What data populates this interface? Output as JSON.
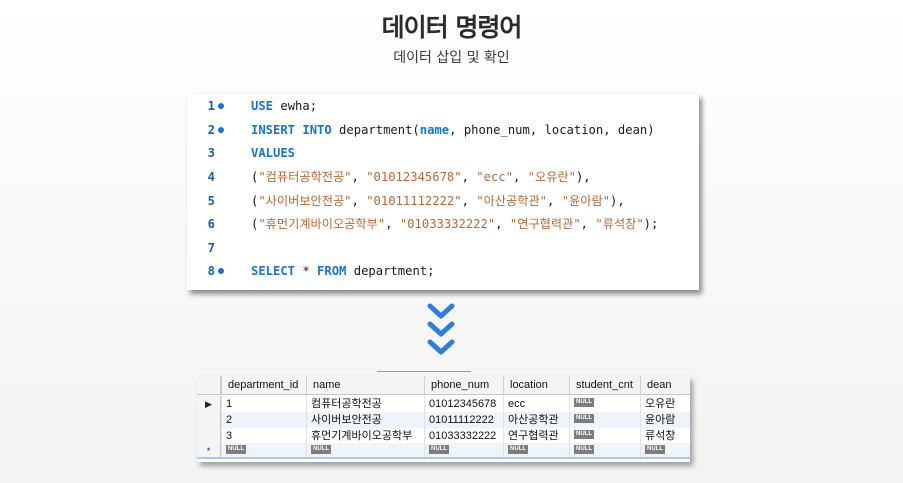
{
  "header": {
    "title": "데이터 명령어",
    "subtitle": "데이터 삽입 및 확인"
  },
  "code_editor": {
    "lines": [
      {
        "num": "1",
        "has_dot": true,
        "tokens": [
          {
            "t": "USE",
            "c": "kw"
          },
          {
            "t": " ewha;",
            "c": "txt"
          }
        ]
      },
      {
        "num": "2",
        "has_dot": true,
        "tokens": [
          {
            "t": "INSERT INTO",
            "c": "kw"
          },
          {
            "t": " department(",
            "c": "txt"
          },
          {
            "t": "name",
            "c": "col"
          },
          {
            "t": ", phone_num, location, dean)",
            "c": "txt"
          }
        ]
      },
      {
        "num": "3",
        "has_dot": false,
        "tokens": [
          {
            "t": "VALUES",
            "c": "kw"
          }
        ]
      },
      {
        "num": "4",
        "has_dot": false,
        "tokens": [
          {
            "t": "(",
            "c": "txt"
          },
          {
            "t": "\"컴퓨터공학전공\"",
            "c": "str"
          },
          {
            "t": ", ",
            "c": "txt"
          },
          {
            "t": "\"01012345678\"",
            "c": "str"
          },
          {
            "t": ", ",
            "c": "txt"
          },
          {
            "t": "\"ecc\"",
            "c": "str"
          },
          {
            "t": ", ",
            "c": "txt"
          },
          {
            "t": "\"오유란\"",
            "c": "str"
          },
          {
            "t": "),",
            "c": "txt"
          }
        ]
      },
      {
        "num": "5",
        "has_dot": false,
        "tokens": [
          {
            "t": "(",
            "c": "txt"
          },
          {
            "t": "\"사이버보안전공\"",
            "c": "str"
          },
          {
            "t": ", ",
            "c": "txt"
          },
          {
            "t": "\"01011112222\"",
            "c": "str"
          },
          {
            "t": ", ",
            "c": "txt"
          },
          {
            "t": "\"아산공학관\"",
            "c": "str"
          },
          {
            "t": ", ",
            "c": "txt"
          },
          {
            "t": "\"윤아람\"",
            "c": "str"
          },
          {
            "t": "),",
            "c": "txt"
          }
        ]
      },
      {
        "num": "6",
        "has_dot": false,
        "tokens": [
          {
            "t": "(",
            "c": "txt"
          },
          {
            "t": "\"휴먼기계바이오공학부\"",
            "c": "str"
          },
          {
            "t": ", ",
            "c": "txt"
          },
          {
            "t": "\"01033332222\"",
            "c": "str"
          },
          {
            "t": ", ",
            "c": "txt"
          },
          {
            "t": "\"연구협력관\"",
            "c": "str"
          },
          {
            "t": ", ",
            "c": "txt"
          },
          {
            "t": "\"류석창\"",
            "c": "str"
          },
          {
            "t": ");",
            "c": "txt"
          }
        ]
      },
      {
        "num": "7",
        "has_dot": false,
        "tokens": []
      },
      {
        "num": "8",
        "has_dot": true,
        "tokens": [
          {
            "t": "SELECT",
            "c": "kw"
          },
          {
            "t": " * ",
            "c": "txt"
          },
          {
            "t": "FROM",
            "c": "kw"
          },
          {
            "t": " department;",
            "c": "txt"
          }
        ]
      }
    ]
  },
  "arrow_icon": "triple-chevron-down-icon",
  "result_grid": {
    "columns": [
      "department_id",
      "name",
      "phone_num",
      "location",
      "student_cnt",
      "dean"
    ],
    "rows": [
      {
        "selector": "▶",
        "cells": [
          "1",
          "컴퓨터공학전공",
          "01012345678",
          "ecc",
          "NULL",
          "오유란"
        ]
      },
      {
        "selector": "",
        "cells": [
          "2",
          "사이버보안전공",
          "01011112222",
          "아산공학관",
          "NULL",
          "윤아람"
        ]
      },
      {
        "selector": "",
        "cells": [
          "3",
          "휴먼기계바이오공학부",
          "01033332222",
          "연구협력관",
          "NULL",
          "류석창"
        ]
      },
      {
        "selector": "*",
        "cells": [
          "NULL",
          "NULL",
          "NULL",
          "NULL",
          "NULL",
          "NULL"
        ]
      }
    ],
    "null_label": "NULL"
  },
  "colors": {
    "keyword": "#1f73c6",
    "string": "#b36a3a",
    "chevron": "#2f7fd8"
  }
}
